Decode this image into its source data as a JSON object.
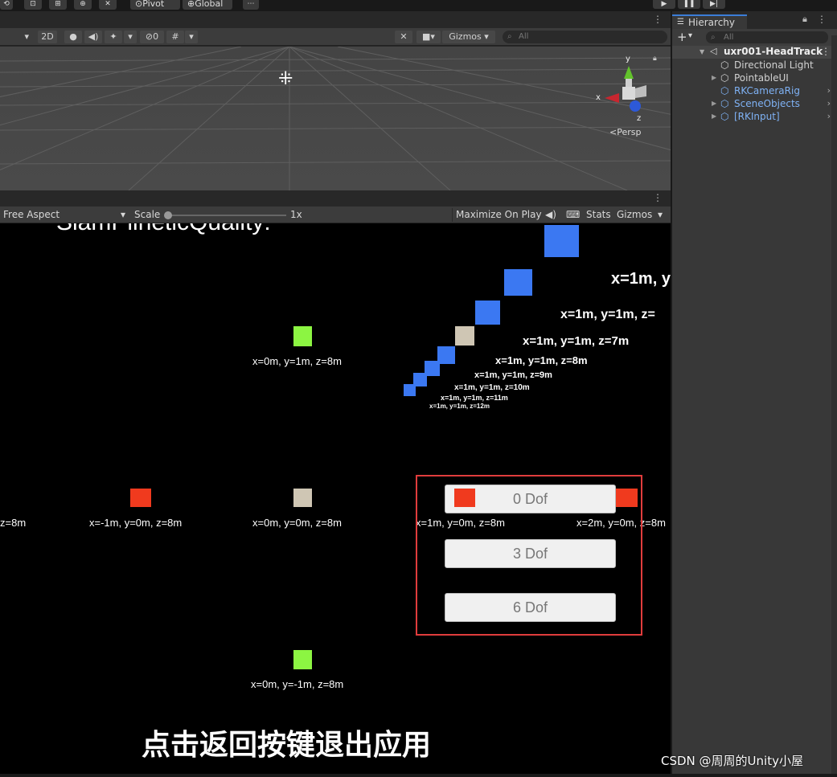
{
  "toolbar": {
    "pivot_label": "Pivot",
    "global_label": "Global"
  },
  "scene": {
    "toolbar": {
      "mode_2d": "2D",
      "hidden_count": "0",
      "gizmos_label": "Gizmos",
      "search_placeholder": "All"
    },
    "gizmo": {
      "axis_x": "x",
      "axis_y": "y",
      "axis_z": "z",
      "projection_label": "Persp"
    }
  },
  "game": {
    "toolbar": {
      "aspect_label": "Free Aspect",
      "scale_label": "Scale",
      "scale_value": "1x",
      "maximize_label": "Maximize On Play",
      "stats_label": "Stats",
      "gizmos_label": "Gizmos"
    },
    "header_text": "SlamPlineticQuality:",
    "cubes": [
      {
        "label": "x=0m, y=1m, z=8m",
        "color": "#8cf542"
      },
      {
        "label": "x=-1m, y=0m, z=8m",
        "color": "#f03a1e"
      },
      {
        "label": "x=0m, y=0m, z=8m",
        "color": "#cfc6b4"
      },
      {
        "label": "x=1m, y=0m, z=8m",
        "color": "#f03a1e"
      },
      {
        "label": "x=2m, y=0m, z=8m",
        "color": "#f03a1e"
      },
      {
        "label": "x=0m, y=-1m, z=8m",
        "color": "#8cf542"
      },
      {
        "label": "z=8m",
        "color": "#f03a1e"
      }
    ],
    "diagonal_labels": [
      "x=1m, y",
      "x=1m, y=1m, z=",
      "x=1m, y=1m, z=7m",
      "x=1m, y=1m, z=8m",
      "x=1m, y=1m, z=9m",
      "x=1m, y=1m, z=10m",
      "x=1m, y=1m, z=11m",
      "x=1m, y=1m, z=12m"
    ],
    "buttons": [
      "0 Dof",
      "3 Dof",
      "6 Dof"
    ],
    "highlight_color": "#e03c3c",
    "bottom_message": "点击返回按键退出应用"
  },
  "hierarchy": {
    "tab_label": "Hierarchy",
    "search_placeholder": "All",
    "scene_name": "uxr001-HeadTrack",
    "items": [
      {
        "label": "Directional Light",
        "prefab": false,
        "expandable": false
      },
      {
        "label": "PointableUI",
        "prefab": false,
        "expandable": true
      },
      {
        "label": "RKCameraRig",
        "prefab": true,
        "expandable": false
      },
      {
        "label": "SceneObjects",
        "prefab": true,
        "expandable": true
      },
      {
        "label": "[RKInput]",
        "prefab": true,
        "expandable": true
      }
    ]
  },
  "watermark": "CSDN @周周的Unity小屋",
  "colors": {
    "cube_blue": "#3b78f2",
    "cube_beige": "#cfc6b4",
    "prefab_blue": "#7fb2f5"
  }
}
